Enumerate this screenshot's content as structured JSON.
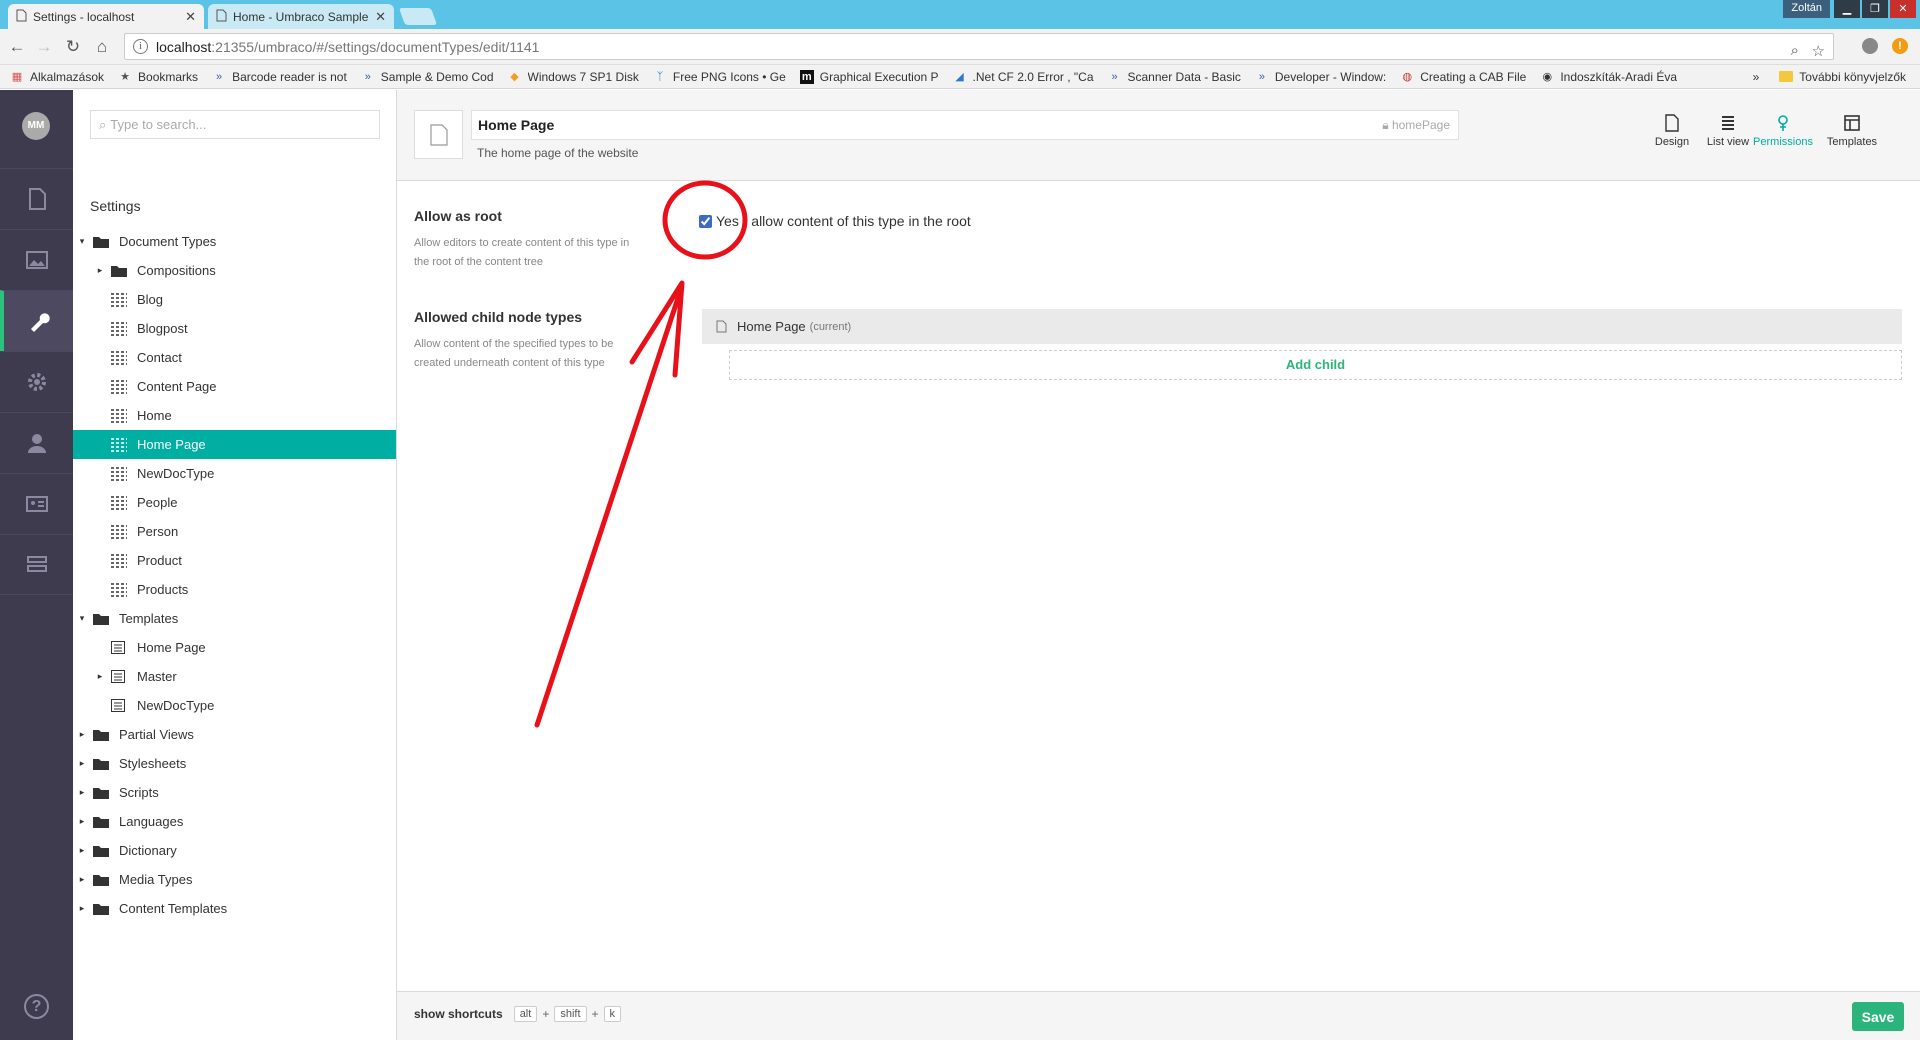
{
  "browser": {
    "tabs": [
      {
        "label": "Settings - localhost",
        "active": true
      },
      {
        "label": "Home - Umbraco Sample",
        "active": false
      }
    ],
    "window_user": "Zoltán",
    "address": {
      "host": "localhost",
      "path": ":21355/umbraco/#/settings/documentTypes/edit/1141"
    },
    "bookmarks": [
      {
        "label": "Alkalmazások",
        "icon": "apps-grid-icon"
      },
      {
        "label": "Bookmarks",
        "icon": "star-icon"
      },
      {
        "label": "Barcode reader is not",
        "icon": "double-chevron-icon"
      },
      {
        "label": "Sample & Demo Cod",
        "icon": "double-chevron-icon"
      },
      {
        "label": "Windows 7 SP1 Disk",
        "icon": "colorful-icon"
      },
      {
        "label": "Free PNG Icons • Ge",
        "icon": "antenna-icon"
      },
      {
        "label": "Graphical Execution P",
        "icon": "m-icon"
      },
      {
        "label": ".Net CF 2.0 Error , \"Ca",
        "icon": "azure-icon"
      },
      {
        "label": "Scanner Data - Basic",
        "icon": "double-chevron-icon"
      },
      {
        "label": "Developer - Window:",
        "icon": "double-chevron-icon"
      },
      {
        "label": "Creating a CAB File",
        "icon": "globe-icon"
      },
      {
        "label": "Indoszkíták-Aradi Éva",
        "icon": "circle-icon"
      }
    ],
    "more_bookmarks": "További könyvjelzők"
  },
  "nav": {
    "avatar_initials": "MM",
    "items": [
      "content",
      "media",
      "settings",
      "developer",
      "users",
      "members",
      "forms"
    ],
    "active": "settings"
  },
  "tree": {
    "search_placeholder": "Type to search...",
    "section_title": "Settings",
    "nodes": [
      {
        "label": "Document Types",
        "level": 0,
        "arrow": "▾",
        "icon": "folder-icon"
      },
      {
        "label": "Compositions",
        "level": 1,
        "arrow": "▸",
        "icon": "folder-icon"
      },
      {
        "label": "Blog",
        "level": 1,
        "arrow": "",
        "icon": "doctype-grid-icon"
      },
      {
        "label": "Blogpost",
        "level": 1,
        "arrow": "",
        "icon": "doctype-grid-icon"
      },
      {
        "label": "Contact",
        "level": 1,
        "arrow": "",
        "icon": "doctype-grid-icon"
      },
      {
        "label": "Content Page",
        "level": 1,
        "arrow": "",
        "icon": "doctype-grid-icon"
      },
      {
        "label": "Home",
        "level": 1,
        "arrow": "",
        "icon": "doctype-grid-icon"
      },
      {
        "label": "Home Page",
        "level": 1,
        "arrow": "",
        "icon": "doctype-grid-icon",
        "selected": true
      },
      {
        "label": "NewDocType",
        "level": 1,
        "arrow": "",
        "icon": "doctype-grid-icon"
      },
      {
        "label": "People",
        "level": 1,
        "arrow": "",
        "icon": "doctype-grid-icon"
      },
      {
        "label": "Person",
        "level": 1,
        "arrow": "",
        "icon": "doctype-grid-icon"
      },
      {
        "label": "Product",
        "level": 1,
        "arrow": "",
        "icon": "doctype-grid-icon"
      },
      {
        "label": "Products",
        "level": 1,
        "arrow": "",
        "icon": "doctype-grid-icon"
      },
      {
        "label": "Templates",
        "level": 0,
        "arrow": "▾",
        "icon": "folder-icon"
      },
      {
        "label": "Home Page",
        "level": 1,
        "arrow": "",
        "icon": "template-icon"
      },
      {
        "label": "Master",
        "level": 1,
        "arrow": "▸",
        "icon": "template-icon"
      },
      {
        "label": "NewDocType",
        "level": 1,
        "arrow": "",
        "icon": "template-icon"
      },
      {
        "label": "Partial Views",
        "level": 0,
        "arrow": "▸",
        "icon": "folder-icon"
      },
      {
        "label": "Stylesheets",
        "level": 0,
        "arrow": "▸",
        "icon": "folder-icon"
      },
      {
        "label": "Scripts",
        "level": 0,
        "arrow": "▸",
        "icon": "folder-icon"
      },
      {
        "label": "Languages",
        "level": 0,
        "arrow": "▸",
        "icon": "folder-icon"
      },
      {
        "label": "Dictionary",
        "level": 0,
        "arrow": "▸",
        "icon": "folder-icon"
      },
      {
        "label": "Media Types",
        "level": 0,
        "arrow": "▸",
        "icon": "folder-icon"
      },
      {
        "label": "Content Templates",
        "level": 0,
        "arrow": "▸",
        "icon": "folder-icon"
      }
    ]
  },
  "editor": {
    "name": "Home Page",
    "alias": "homePage",
    "description": "The home page of the website",
    "app_tabs": [
      {
        "label": "Design",
        "icon": "document-icon",
        "active": false
      },
      {
        "label": "List view",
        "icon": "list-icon",
        "active": false
      },
      {
        "label": "Permissions",
        "icon": "permissions-icon",
        "active": true
      },
      {
        "label": "Templates",
        "icon": "template-icon",
        "active": false
      }
    ],
    "allow_root": {
      "label": "Allow as root",
      "description": "Allow editors to create content of this type in the root of the content tree",
      "checkbox_label": "Yes - allow content of this type in the root",
      "checked": true
    },
    "allowed_children": {
      "label": "Allowed child node types",
      "description": "Allow content of the specified types to be created underneath content of this type",
      "item_name": "Home Page",
      "item_suffix": "(current)",
      "add_label": "Add child"
    }
  },
  "footer": {
    "shortcuts_label": "show shortcuts",
    "keys": [
      "alt",
      "shift",
      "k"
    ],
    "save_label": "Save"
  },
  "colors": {
    "sidebar": "#3e3b4f",
    "accent": "#00aea2",
    "save": "#2bb57c",
    "annotation": "#e8111a"
  }
}
